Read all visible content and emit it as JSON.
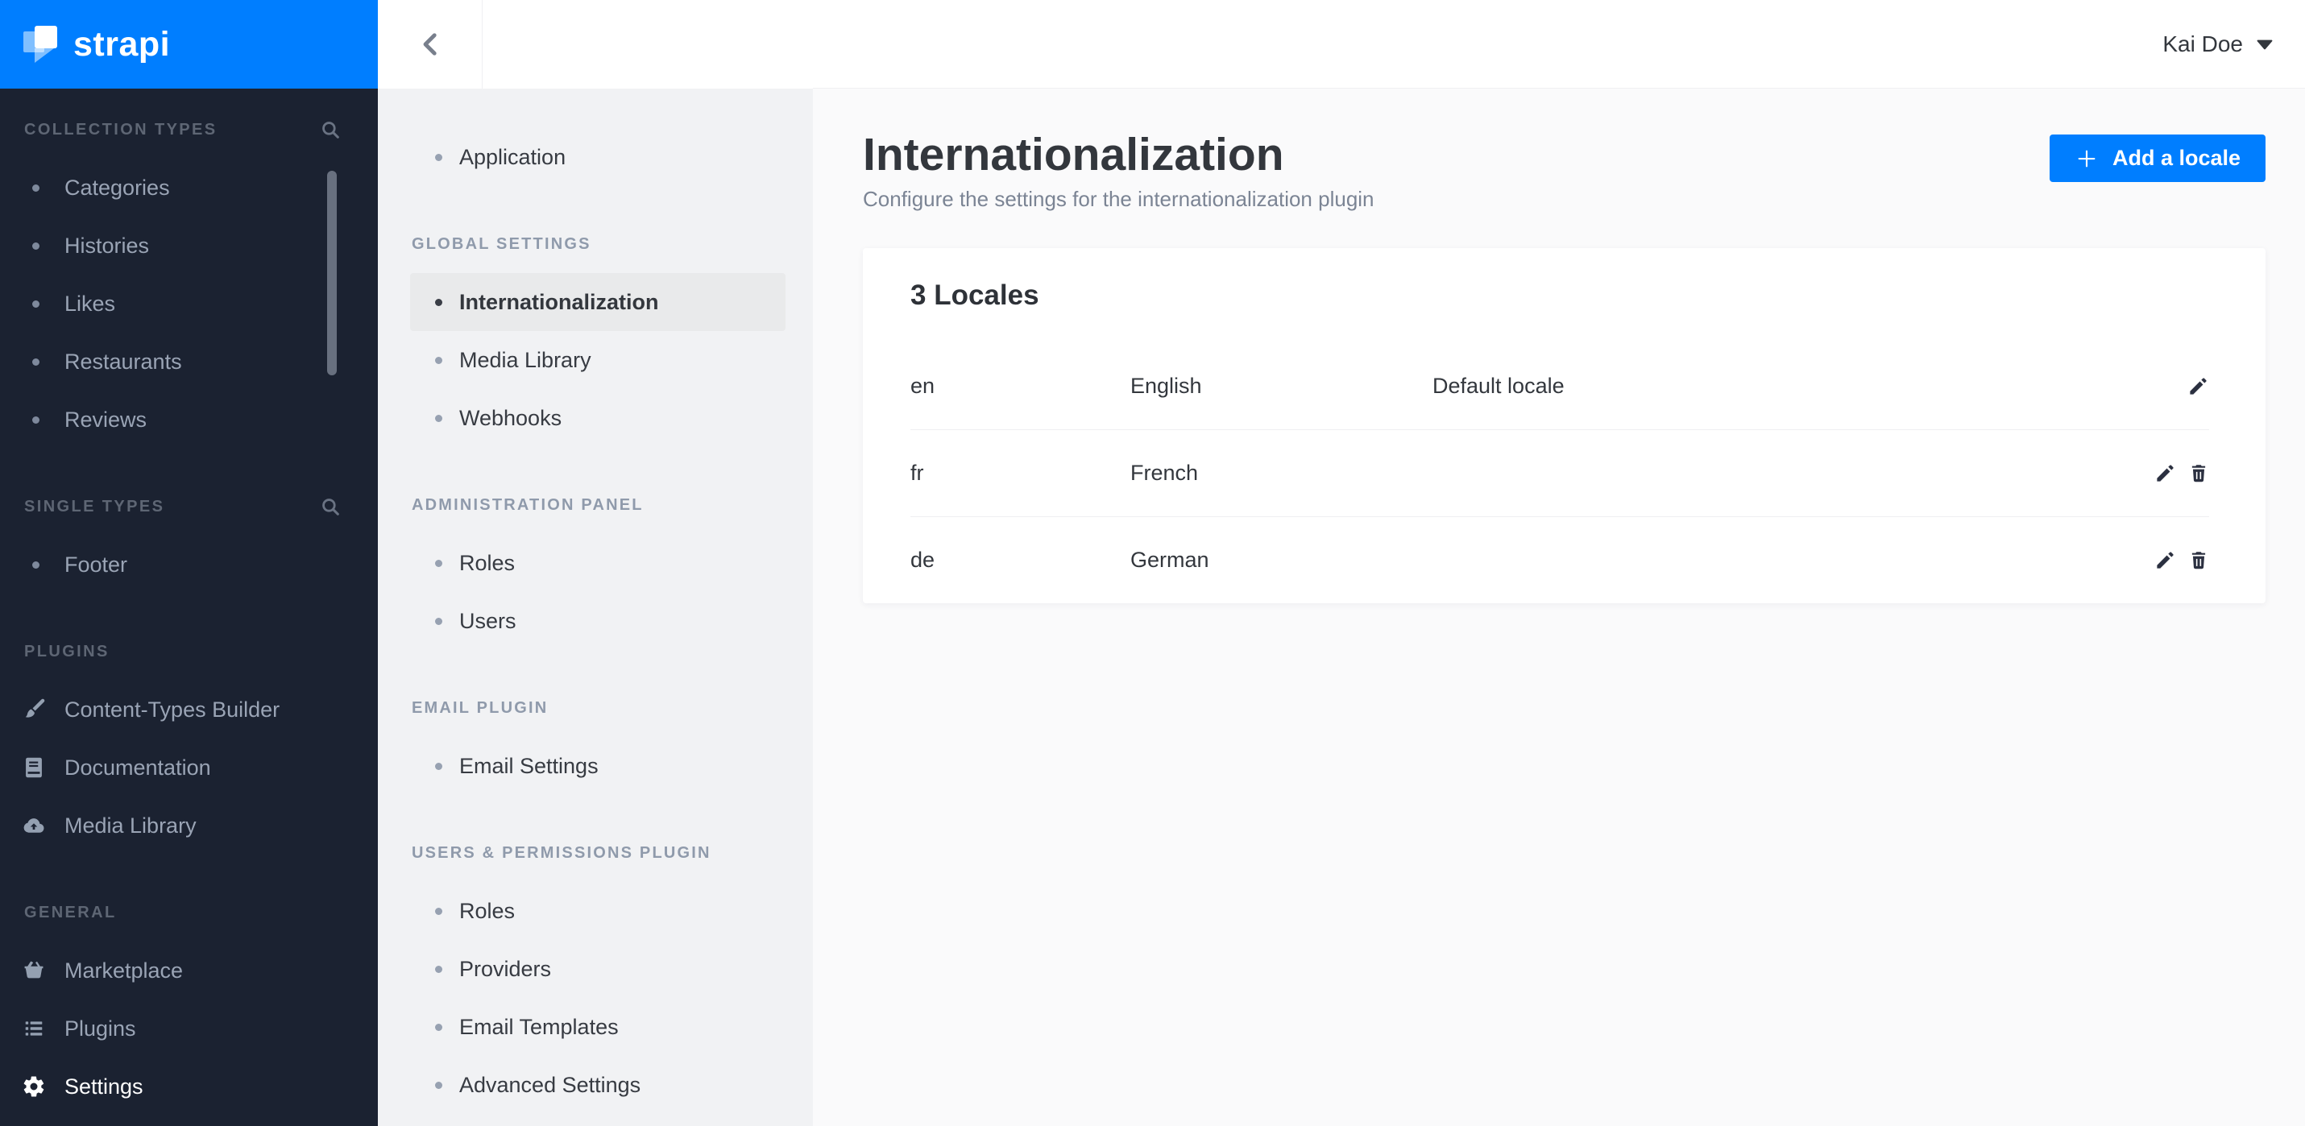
{
  "brand": {
    "logo_text": "strapi",
    "primary_color": "#007EFF"
  },
  "colors": {
    "sidebar_bg": "#1B2231",
    "sidebar_text": "#9AA4B5",
    "settings_sidebar_bg": "#F1F2F4",
    "active_item_bg": "#E9EAEB",
    "content_bg": "#FAFAFB",
    "text_dark": "#33373D",
    "icon_dark": "#2B3040"
  },
  "left_sidebar": {
    "sections": [
      {
        "label": "COLLECTION TYPES",
        "has_search": true,
        "items": [
          {
            "label": "Categories",
            "icon": "dot"
          },
          {
            "label": "Histories",
            "icon": "dot"
          },
          {
            "label": "Likes",
            "icon": "dot"
          },
          {
            "label": "Restaurants",
            "icon": "dot"
          },
          {
            "label": "Reviews",
            "icon": "dot"
          }
        ]
      },
      {
        "label": "SINGLE TYPES",
        "has_search": true,
        "items": [
          {
            "label": "Footer",
            "icon": "dot"
          }
        ]
      },
      {
        "label": "PLUGINS",
        "has_search": false,
        "items": [
          {
            "label": "Content-Types Builder",
            "icon": "paintbrush-icon"
          },
          {
            "label": "Documentation",
            "icon": "book-icon"
          },
          {
            "label": "Media Library",
            "icon": "cloud-upload-icon"
          }
        ]
      },
      {
        "label": "GENERAL",
        "has_search": false,
        "items": [
          {
            "label": "Marketplace",
            "icon": "basket-icon"
          },
          {
            "label": "Plugins",
            "icon": "list-icon"
          },
          {
            "label": "Settings",
            "icon": "gear-icon",
            "active": true
          }
        ]
      }
    ]
  },
  "settings_sidebar": {
    "top_item": {
      "label": "Application"
    },
    "sections": [
      {
        "label": "GLOBAL SETTINGS",
        "items": [
          {
            "label": "Internationalization",
            "active": true
          },
          {
            "label": "Media Library"
          },
          {
            "label": "Webhooks"
          }
        ]
      },
      {
        "label": "ADMINISTRATION PANEL",
        "items": [
          {
            "label": "Roles"
          },
          {
            "label": "Users"
          }
        ]
      },
      {
        "label": "EMAIL PLUGIN",
        "items": [
          {
            "label": "Email Settings"
          }
        ]
      },
      {
        "label": "USERS & PERMISSIONS PLUGIN",
        "items": [
          {
            "label": "Roles"
          },
          {
            "label": "Providers"
          },
          {
            "label": "Email Templates"
          },
          {
            "label": "Advanced Settings"
          }
        ]
      }
    ]
  },
  "topbar": {
    "user_name": "Kai Doe"
  },
  "page": {
    "title": "Internationalization",
    "subtitle": "Configure the settings for the internationalization plugin",
    "add_button_label": "Add a locale"
  },
  "locales_card": {
    "heading": "3 Locales",
    "rows": [
      {
        "code": "en",
        "name": "English",
        "note": "Default locale",
        "can_delete": false
      },
      {
        "code": "fr",
        "name": "French",
        "note": "",
        "can_delete": true
      },
      {
        "code": "de",
        "name": "German",
        "note": "",
        "can_delete": true
      }
    ]
  }
}
